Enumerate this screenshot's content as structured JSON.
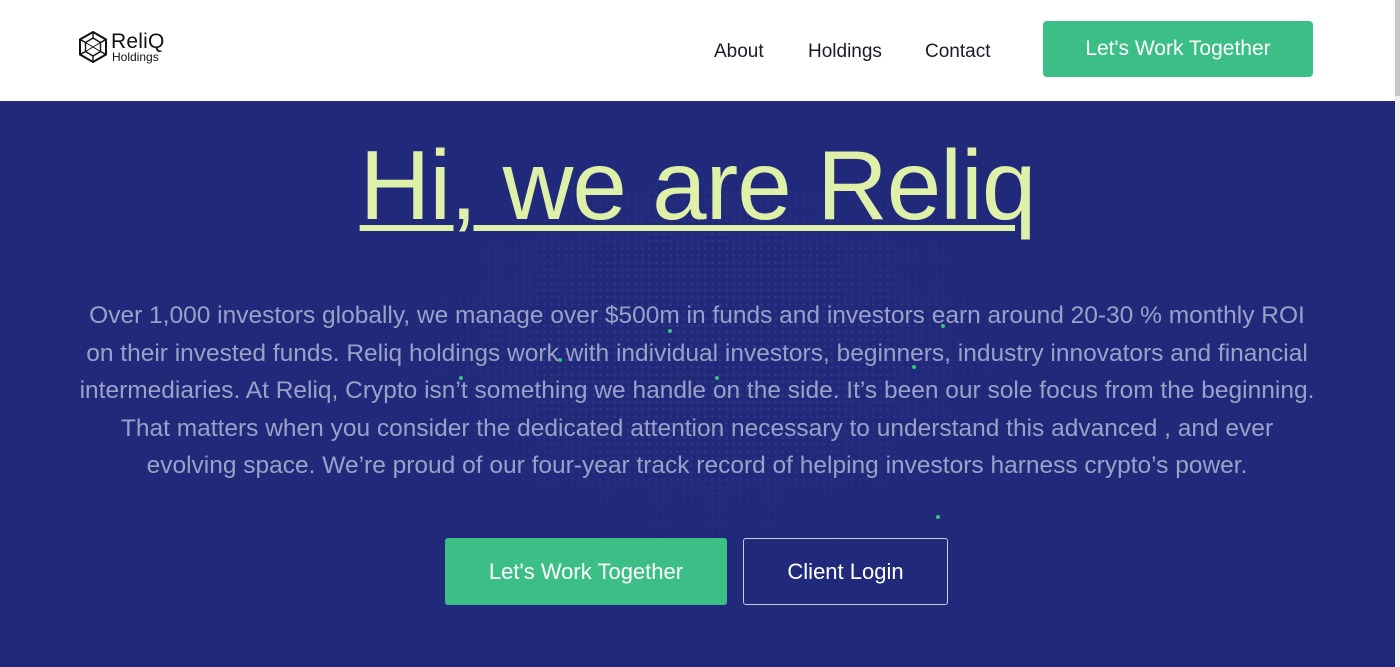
{
  "header": {
    "logo": {
      "name": "ReliQ",
      "subtitle": "Holdings",
      "icon": "hexagon-network-icon"
    },
    "nav": [
      {
        "label": "About"
      },
      {
        "label": "Holdings"
      },
      {
        "label": "Contact"
      }
    ],
    "cta_label": "Let's Work Together"
  },
  "hero": {
    "title": "Hi, we are Reliq",
    "description": "Over 1,000 investors globally, we manage over $500m in funds and investors earn around 20-30 % monthly ROI on their invested funds. Reliq holdings work with individual investors, beginners, industry innovators and financial intermediaries. At Reliq, Crypto isn’t something we handle on the side. It’s been our sole focus from the beginning. That matters when you consider the dedicated attention necessary to understand this advanced , and ever evolving space. We’re proud of our four-year track record of helping investors harness crypto’s power.",
    "primary_button": "Let's Work Together",
    "secondary_button": "Client Login"
  },
  "colors": {
    "background": "#212a7a",
    "accent": "#3bbf86",
    "title": "#dff0a8",
    "body_text": "#9aa1c8"
  }
}
